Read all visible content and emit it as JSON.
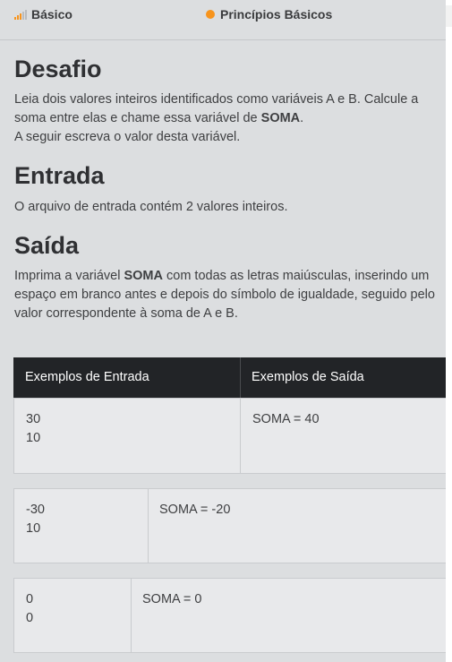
{
  "header": {
    "level_label": "Básico",
    "level_icon": "signal-bars-icon",
    "category_label": "Princípios Básicos",
    "category_color": "#f7941d"
  },
  "sections": {
    "desafio_title": "Desafio",
    "desafio_text_1": "Leia dois valores inteiros identificados como variáveis A e B. Calcule a soma entre elas e chame essa variável de ",
    "desafio_bold": "SOMA",
    "desafio_text_2": ".",
    "desafio_text_3": "A seguir escreva o valor desta variável.",
    "entrada_title": "Entrada",
    "entrada_text": "O arquivo de entrada contém 2 valores inteiros.",
    "saida_title": "Saída",
    "saida_text_1": "Imprima a variável ",
    "saida_bold": "SOMA",
    "saida_text_2": " com todas as letras maiúsculas, inserindo um espaço em branco antes e depois do símbolo de igualdade, seguido pelo valor correspondente à soma de A e B."
  },
  "examples": {
    "input_header": "Exemplos de Entrada",
    "output_header": "Exemplos de Saída",
    "rows": [
      {
        "input_line_1": "30",
        "input_line_2": "10",
        "output": "SOMA = 40"
      },
      {
        "input_line_1": "-30",
        "input_line_2": "10",
        "output": "SOMA = -20"
      },
      {
        "input_line_1": "0",
        "input_line_2": "0",
        "output": "SOMA = 0"
      }
    ]
  },
  "colors": {
    "accent_orange": "#f7941d",
    "table_header_bg": "#222427"
  }
}
